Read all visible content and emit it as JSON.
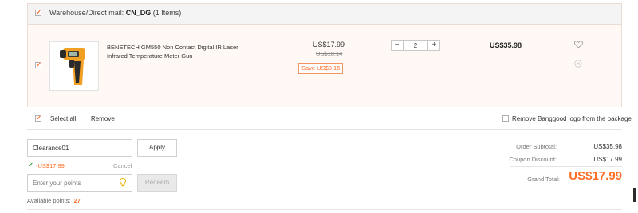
{
  "warehouse": {
    "label": "Warehouse/Direct mail:",
    "code": "CN_DG",
    "count": "(1 Items)"
  },
  "product": {
    "name_line1": "BENETECH GM550 Non Contact Digital IR Laser",
    "name_line2": "Infrared Temperature Meter Gun",
    "price": "US$17.99",
    "original_price": "US$18.14",
    "save": "Save US$0.15",
    "quantity": "2",
    "subtotal": "US$35.98"
  },
  "actions": {
    "select_all": "Select all",
    "remove": "Remove",
    "remove_logo": "Remove Banggood logo from the package"
  },
  "coupon": {
    "value": "Clearance01",
    "apply_label": "Apply",
    "applied_discount": "-US$17.99",
    "cancel_label": "Cancel"
  },
  "points": {
    "placeholder": "Enter your points",
    "redeem_label": "Redeem",
    "available_label": "Available points:",
    "available_value": "27"
  },
  "summary": {
    "order_subtotal_label": "Order Subtotal:",
    "order_subtotal_value": "US$35.98",
    "coupon_discount_label": "Coupon Discount:",
    "coupon_discount_value": "US$17.99",
    "grand_total_label": "Grand Total:",
    "grand_total_value": "US$17.99"
  },
  "colors": {
    "accent": "#ff6e26",
    "check_green": "#2e9f2e"
  },
  "icons": {
    "wishlist": "heart-icon",
    "delete": "close-circle-icon",
    "points": "lightbulb-icon",
    "applied": "check-icon"
  }
}
